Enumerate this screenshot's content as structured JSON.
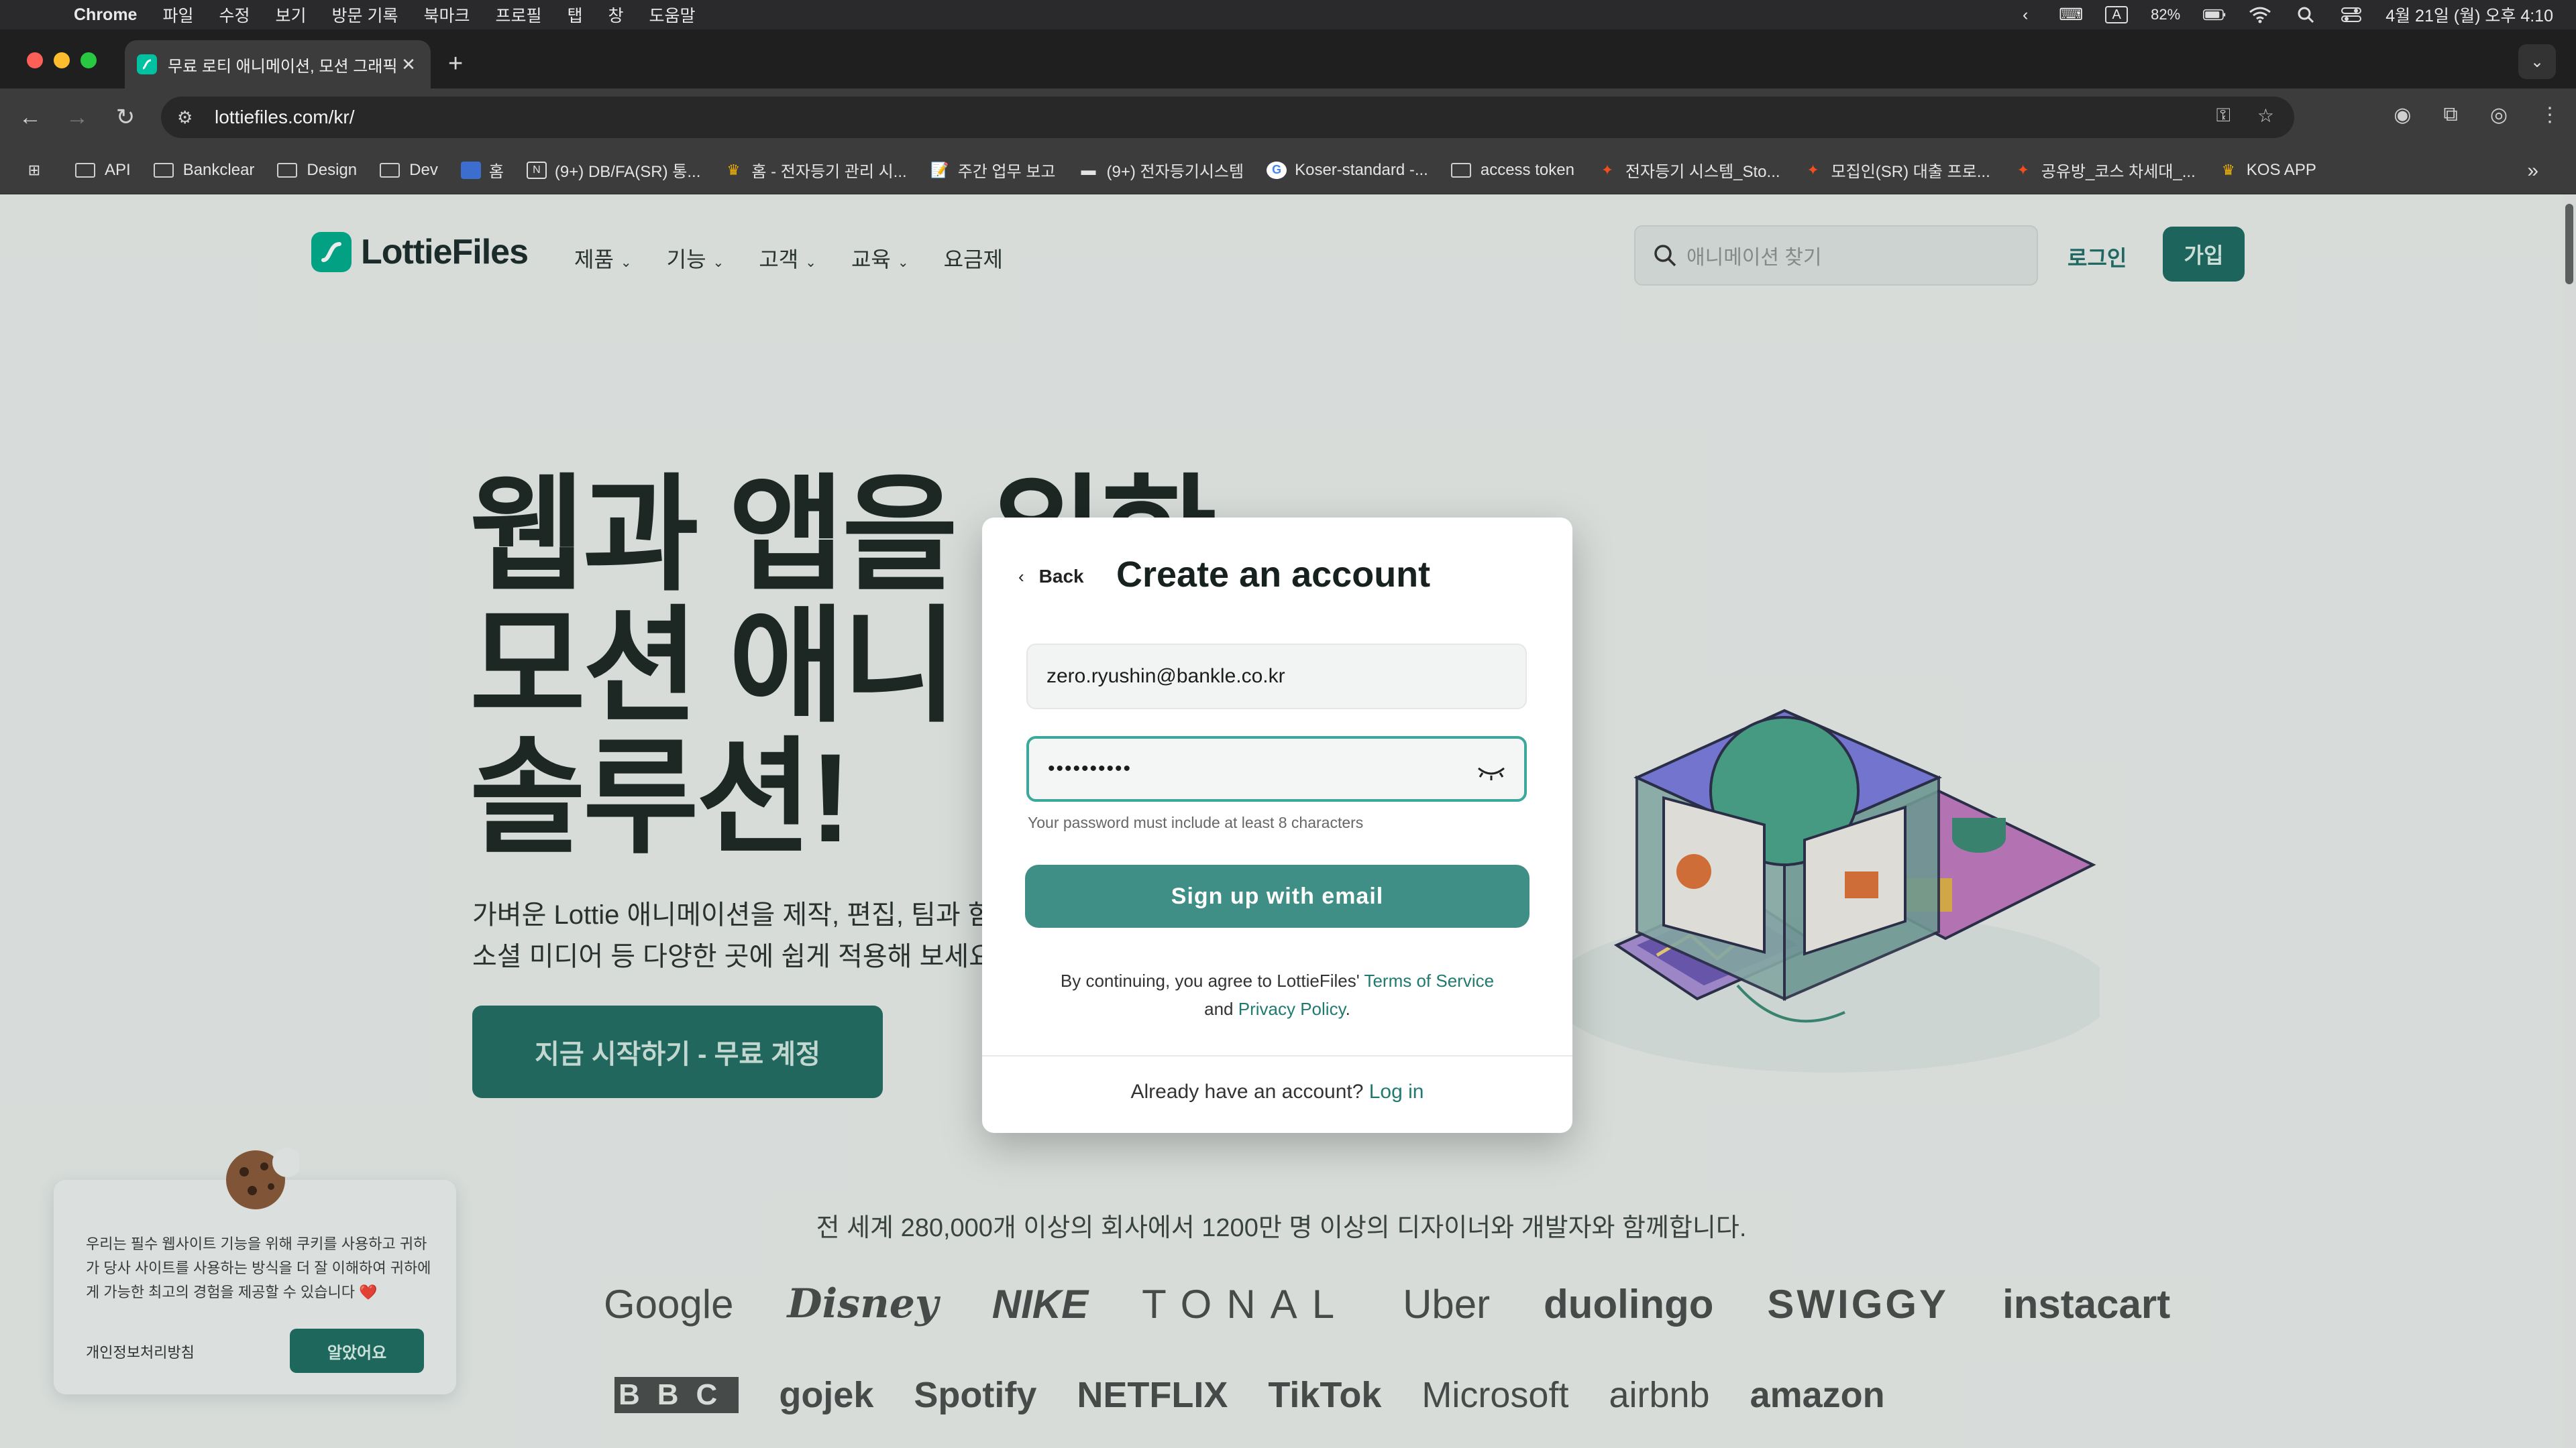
{
  "menubar": {
    "app": "Chrome",
    "items": [
      "파일",
      "수정",
      "보기",
      "방문 기록",
      "북마크",
      "프로필",
      "탭",
      "창",
      "도움말"
    ],
    "battery": "82%",
    "clock": "4월 21일 (월) 오후 4:10",
    "input_mode": "A"
  },
  "tab": {
    "title": "무료 로티 애니메이션, 모션 그래픽..."
  },
  "address": {
    "url": "lottiefiles.com/kr/"
  },
  "bookmarks": [
    "API",
    "Bankclear",
    "Design",
    "Dev",
    "홈",
    "(9+) DB/FA(SR) 통...",
    "홈 - 전자등기 관리 시...",
    "주간 업무 보고",
    "(9+) 전자등기시스템",
    "Koser-standard -...",
    "access token",
    "전자등기 시스템_Sto...",
    "모집인(SR) 대출 프로...",
    "공유방_코스 차세대_...",
    "KOS APP"
  ],
  "site": {
    "brand": "LottieFiles",
    "nav": [
      "제품",
      "기능",
      "고객",
      "교육",
      "요금제"
    ],
    "search_placeholder": "애니메이션 찾기",
    "login": "로그인",
    "signup": "가입",
    "hero_lines": [
      "웹과 앱을 위한",
      "모션 애니",
      "솔루션!"
    ],
    "hero_desc_lines": [
      "가벼운 Lottie 애니메이션을 제작, 편집, 팀과 함",
      "소셜 미디어 등 다양한 곳에 쉽게 적용해 보세요."
    ],
    "cta": "지금 시작하기 - 무료 계정",
    "trust": "전 세계 280,000개 이상의 회사에서 1200만 명 이상의 디자이너와 개발자와 함께합니다.",
    "logos_row1": [
      "Google",
      "Disney",
      "NIKE",
      "TONAL",
      "Uber",
      "duolingo",
      "SWIGGY",
      "instacart"
    ],
    "logos_row2": [
      "BBC",
      "gojek",
      "Spotify",
      "NETFLIX",
      "TikTok",
      "Microsoft",
      "airbnb",
      "amazon"
    ]
  },
  "cookie": {
    "text": "우리는 필수 웹사이트 기능을 위해 쿠키를 사용하고 귀하가 당사 사이트를 사용하는 방식을 더 잘 이해하여 귀하에게 가능한 최고의 경험을 제공할 수 있습니다 ❤️",
    "policy": "개인정보처리방침",
    "ok": "알았어요"
  },
  "modal": {
    "back": "Back",
    "title": "Create an account",
    "email_value": "zero.ryushin@bankle.co.kr",
    "password_mask": "••••••••••",
    "hint": "Your password must include at least 8 characters",
    "submit": "Sign up with email",
    "legal_prefix": "By continuing, you agree to LottieFiles'",
    "terms": "Terms of Service",
    "and": "and",
    "privacy": "Privacy Policy",
    "period": ".",
    "footer_prefix": "Already have an account?",
    "login": "Log in"
  },
  "colors": {
    "brand": "#00ad8e",
    "primary_button": "#3f8f87",
    "link": "#217a70"
  }
}
